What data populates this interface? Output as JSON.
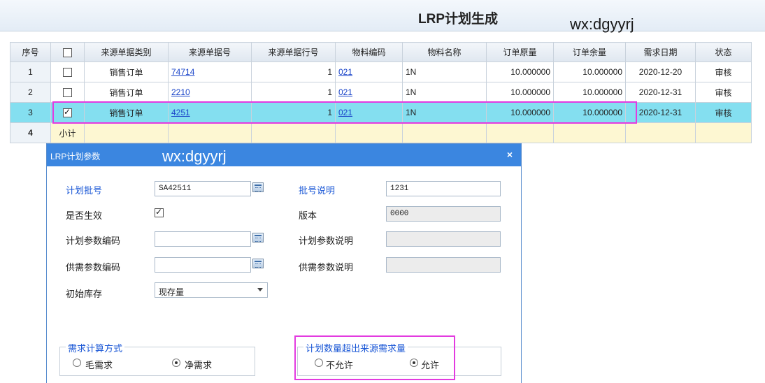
{
  "window": {
    "title": "LRP计划生成",
    "watermark": "wx:dgyyrj"
  },
  "grid": {
    "headers": [
      "序号",
      "来源单据类别",
      "来源单据号",
      "来源单据行号",
      "物料编码",
      "物料名称",
      "订单原量",
      "订单余量",
      "需求日期",
      "状态"
    ],
    "rows": [
      {
        "seq": "1",
        "checked": false,
        "type": "销售订单",
        "no": "74714",
        "line": "1",
        "code": "021",
        "name": "1N",
        "qty": "10.000000",
        "remain": "10.000000",
        "date": "2020-12-20",
        "status": "审核"
      },
      {
        "seq": "2",
        "checked": false,
        "type": "销售订单",
        "no": "2210",
        "line": "1",
        "code": "021",
        "name": "1N",
        "qty": "10.000000",
        "remain": "10.000000",
        "date": "2020-12-31",
        "status": "审核"
      },
      {
        "seq": "3",
        "checked": true,
        "type": "销售订单",
        "no": "4251",
        "line": "1",
        "code": "021",
        "name": "1N",
        "qty": "10.000000",
        "remain": "10.000000",
        "date": "2020-12-31",
        "status": "审核"
      }
    ],
    "summary": {
      "seq": "4",
      "label": "小计"
    }
  },
  "dialog": {
    "title": "LRP计划参数",
    "watermark": "wx:dgyyrj",
    "close": "×",
    "plan_batch_label": "计划批号",
    "plan_batch_value": "SA42511",
    "batch_desc_label": "批号说明",
    "batch_desc_value": "1231",
    "effective_label": "是否生效",
    "version_label": "版本",
    "version_value": "0000",
    "param_code_label": "计划参数编码",
    "param_desc_label": "计划参数说明",
    "supply_code_label": "供需参数编码",
    "supply_desc_label": "供需参数说明",
    "init_stock_label": "初始库存",
    "init_stock_value": "现存量",
    "demand_group": {
      "legend": "需求计算方式",
      "gross": "毛需求",
      "net": "净需求",
      "selected": "net"
    },
    "exceed_group": {
      "legend": "计划数量超出来源需求量",
      "deny": "不允许",
      "allow": "允许",
      "selected": "allow"
    }
  },
  "colors": {
    "accent": "#3b86e0",
    "highlight": "#e33be0",
    "selected_row": "#84dff0",
    "summary_row": "#fdf7d2"
  }
}
